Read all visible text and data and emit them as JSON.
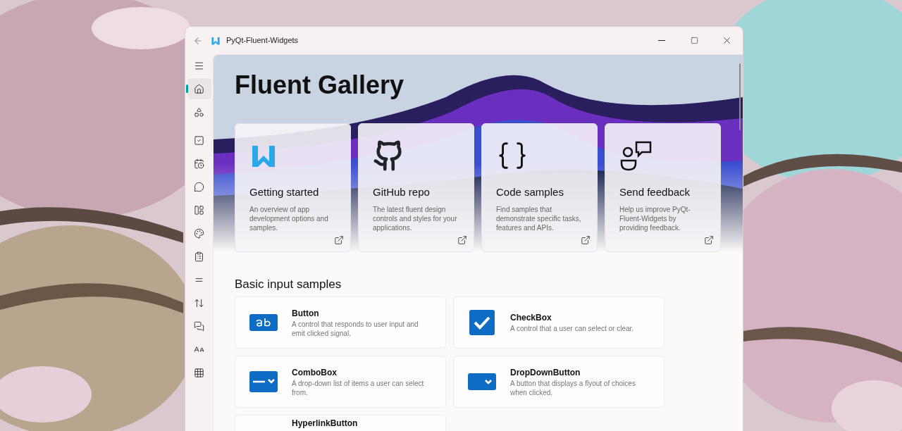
{
  "window": {
    "title": "PyQt-Fluent-Widgets"
  },
  "nav": [
    {
      "selected": false
    },
    {
      "selected": true
    },
    {
      "selected": false
    },
    {
      "selected": false
    },
    {
      "selected": false
    },
    {
      "selected": false
    },
    {
      "selected": false
    },
    {
      "selected": false
    },
    {
      "selected": false
    },
    {
      "selected": false
    },
    {
      "selected": false
    },
    {
      "selected": false
    },
    {
      "selected": false
    },
    {
      "selected": false
    }
  ],
  "hero": {
    "title": "Fluent Gallery"
  },
  "cards": [
    {
      "kind": "logo",
      "title": "Getting started",
      "description": "An overview of app development options and samples."
    },
    {
      "kind": "github",
      "title": "GitHub repo",
      "description": "The latest fluent design controls and styles for your applications."
    },
    {
      "kind": "code",
      "title": "Code samples",
      "description": "Find samples that demonstrate specific tasks, features and APIs."
    },
    {
      "kind": "feedback",
      "title": "Send feedback",
      "description": "Help us improve PyQt-Fluent-Widgets by providing feedback."
    }
  ],
  "section": {
    "title": "Basic input samples"
  },
  "samples": [
    {
      "kind": "button",
      "title": "Button",
      "description": "A control that responds to user input and emit clicked signal."
    },
    {
      "kind": "checkbox",
      "title": "CheckBox",
      "description": "A control that a user can select or clear."
    },
    {
      "kind": "combobox",
      "title": "ComboBox",
      "description": "A drop-down list of items a user can select from."
    },
    {
      "kind": "dropdown",
      "title": "DropDownButton",
      "description": "A button that displays a flyout of choices when clicked."
    },
    {
      "kind": "hyperlink",
      "title": "HyperlinkButton"
    }
  ]
}
